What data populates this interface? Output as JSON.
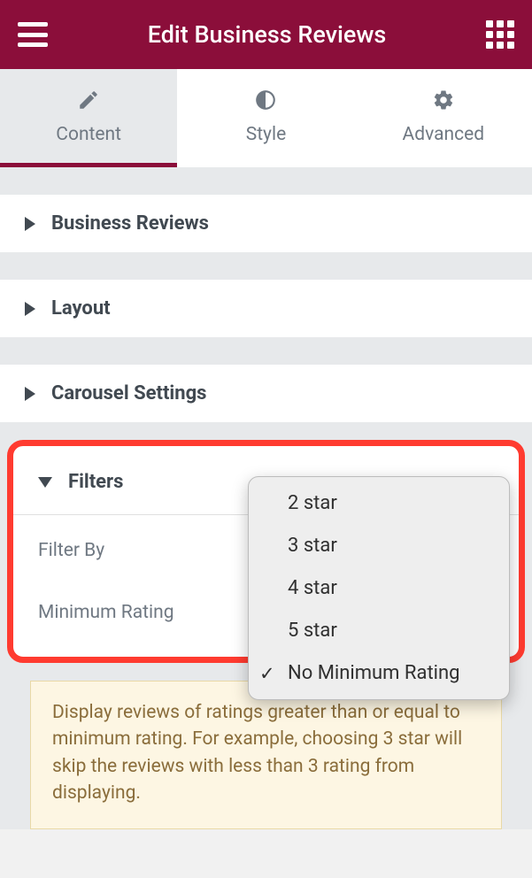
{
  "header": {
    "title": "Edit Business Reviews"
  },
  "tabs": [
    {
      "label": "Content",
      "active": true
    },
    {
      "label": "Style",
      "active": false
    },
    {
      "label": "Advanced",
      "active": false
    }
  ],
  "sections": [
    {
      "label": "Business Reviews",
      "expanded": false
    },
    {
      "label": "Layout",
      "expanded": false
    },
    {
      "label": "Carousel Settings",
      "expanded": false
    }
  ],
  "filters": {
    "title": "Filters",
    "fields": {
      "filter_by_label": "Filter By",
      "minimum_rating_label": "Minimum Rating"
    },
    "dropdown_options": [
      {
        "label": "2 star",
        "selected": false
      },
      {
        "label": "3 star",
        "selected": false
      },
      {
        "label": "4 star",
        "selected": false
      },
      {
        "label": "5 star",
        "selected": false
      },
      {
        "label": "No Minimum Rating",
        "selected": true
      }
    ],
    "hint": "Display reviews of ratings greater than or equal to minimum rating. For example, choosing 3 star will skip the reviews with less than 3 rating from displaying."
  }
}
